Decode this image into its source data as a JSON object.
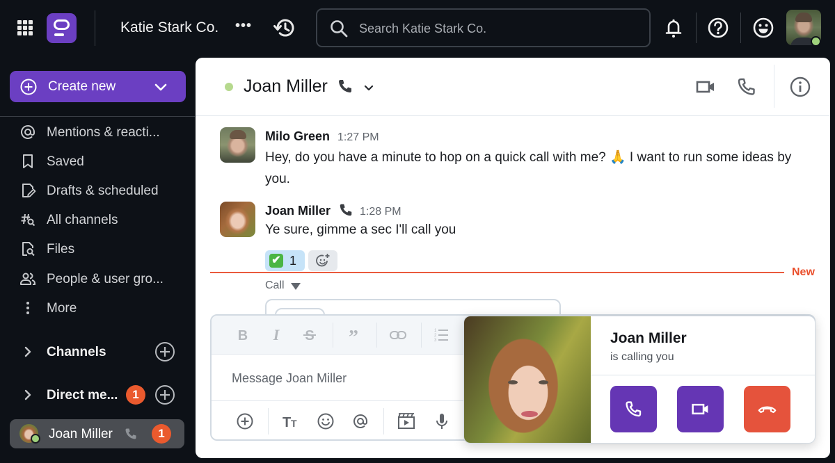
{
  "topbar": {
    "org_name": "Katie Stark Co.",
    "org_more": "•••",
    "search_placeholder": "Search Katie Stark Co.",
    "user_status_color": "#9fd27c"
  },
  "sidebar": {
    "create_new_label": "Create new",
    "nav_items": [
      {
        "label": "Mentions & reacti...",
        "icon": "at-icon"
      },
      {
        "label": "Saved",
        "icon": "bookmark-icon"
      },
      {
        "label": "Drafts & scheduled",
        "icon": "draft-icon"
      },
      {
        "label": "All channels",
        "icon": "channel-search-icon"
      },
      {
        "label": "Files",
        "icon": "file-search-icon"
      },
      {
        "label": "People & user gro...",
        "icon": "people-icon"
      },
      {
        "label": "More",
        "icon": "more-vertical-icon"
      }
    ],
    "sections": [
      {
        "label": "Channels",
        "badge": null
      },
      {
        "label": "Direct me...",
        "badge": "1"
      }
    ],
    "active_dm": {
      "label": "Joan Miller",
      "badge": "1",
      "status": "online"
    }
  },
  "channel": {
    "title": "Joan Miller",
    "status_color": "#b6d98e"
  },
  "messages": [
    {
      "author": "Milo Green",
      "time": "1:27 PM",
      "text": "Hey, do you have a minute to hop on a quick call with me? 🙏 I want to run some ideas by you."
    },
    {
      "author": "Joan Miller",
      "time": "1:28 PM",
      "text": "Ye sure, gimme a sec I'll call you",
      "reactions": [
        {
          "emoji": "✔",
          "count": "1"
        }
      ]
    }
  ],
  "divider": {
    "new_label": "New"
  },
  "call_block": {
    "label": "Call"
  },
  "composer": {
    "placeholder": "Message Joan Miller"
  },
  "incoming_call": {
    "caller": "Joan Miller",
    "subtitle": "is calling you",
    "accept_color": "#6536b4",
    "video_color": "#6536b4",
    "decline_color": "#e5533c"
  }
}
